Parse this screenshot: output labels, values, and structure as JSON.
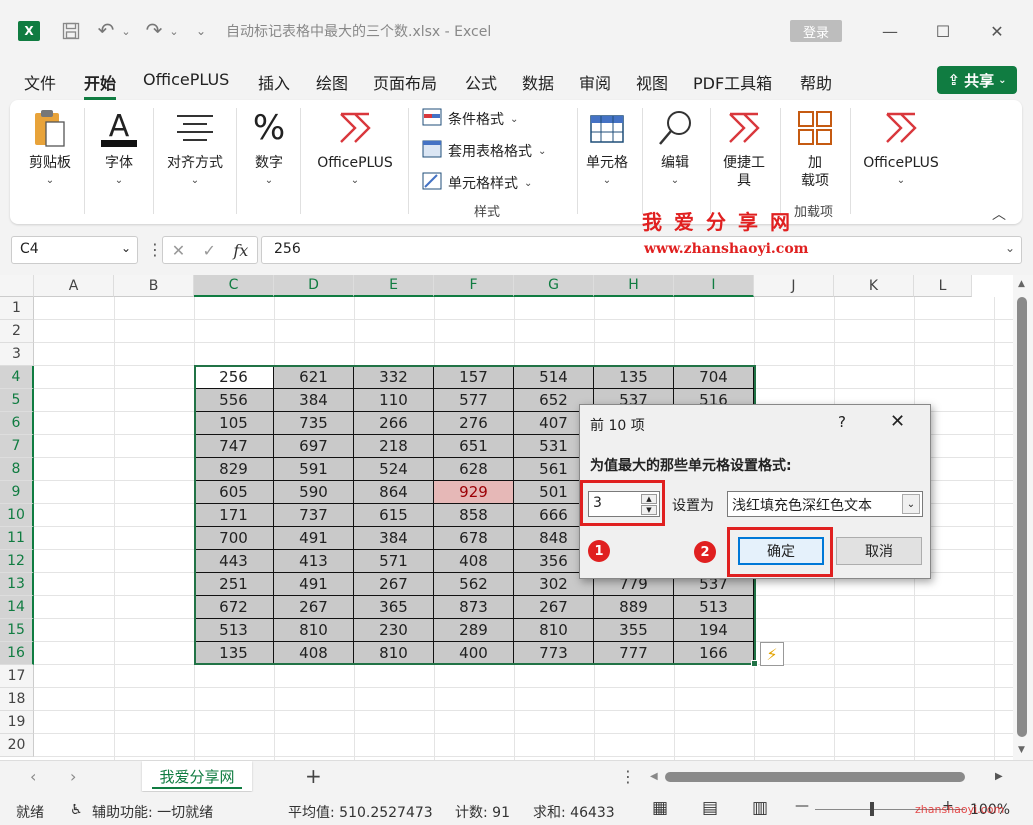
{
  "app": {
    "logo_letter": "X",
    "title": "自动标记表格中最大的三个数.xlsx  -  Excel",
    "login": "登录",
    "undo": "↶",
    "redo": "↷",
    "customize": "⌄"
  },
  "menu": {
    "tabs": [
      "文件",
      "开始",
      "OfficePLUS",
      "插入",
      "绘图",
      "页面布局",
      "公式",
      "数据",
      "审阅",
      "视图",
      "PDF工具箱",
      "帮助"
    ],
    "share": "共享"
  },
  "ribbon": {
    "paste": "剪贴板",
    "font": "字体",
    "align": "对齐方式",
    "number": "数字",
    "officeplus1": "OfficePLUS",
    "cond_format": "条件格式",
    "table_format": "套用表格格式",
    "cell_style": "单元格样式",
    "styles_group": "样式",
    "cells": "单元格",
    "edit": "编辑",
    "tools_line1": "便捷工",
    "tools_line2": "具",
    "addin_line1": "加",
    "addin_line2": "载项",
    "addin_group": "加载项",
    "officeplus2": "OfficePLUS"
  },
  "formula_bar": {
    "name_box": "C4",
    "formula": "256"
  },
  "columns": [
    "A",
    "B",
    "C",
    "D",
    "E",
    "F",
    "G",
    "H",
    "I",
    "J",
    "K",
    "L"
  ],
  "rows": [
    "1",
    "2",
    "3",
    "4",
    "5",
    "6",
    "7",
    "8",
    "9",
    "10",
    "11",
    "12",
    "13",
    "14",
    "15",
    "16",
    "17",
    "18",
    "19",
    "20"
  ],
  "table": [
    [
      "256",
      "621",
      "332",
      "157",
      "514",
      "135",
      "704"
    ],
    [
      "556",
      "384",
      "110",
      "577",
      "652",
      "537",
      "516"
    ],
    [
      "105",
      "735",
      "266",
      "276",
      "407",
      "",
      ""
    ],
    [
      "747",
      "697",
      "218",
      "651",
      "531",
      "",
      ""
    ],
    [
      "829",
      "591",
      "524",
      "628",
      "561",
      "",
      ""
    ],
    [
      "605",
      "590",
      "864",
      "929",
      "501",
      "",
      ""
    ],
    [
      "171",
      "737",
      "615",
      "858",
      "666",
      "",
      ""
    ],
    [
      "700",
      "491",
      "384",
      "678",
      "848",
      "",
      ""
    ],
    [
      "443",
      "413",
      "571",
      "408",
      "356",
      "",
      ""
    ],
    [
      "251",
      "491",
      "267",
      "562",
      "302",
      "779",
      "537"
    ],
    [
      "672",
      "267",
      "365",
      "873",
      "267",
      "889",
      "513"
    ],
    [
      "513",
      "810",
      "230",
      "289",
      "810",
      "355",
      "194"
    ],
    [
      "135",
      "408",
      "810",
      "400",
      "773",
      "777",
      "166"
    ]
  ],
  "dialog": {
    "title": "前 10 项",
    "help": "?",
    "close": "✕",
    "prompt": "为值最大的那些单元格设置格式:",
    "count": "3",
    "set_as": "设置为",
    "format": "浅红填充色深红色文本",
    "ok": "确定",
    "cancel": "取消"
  },
  "annotations": {
    "badge1": "1",
    "badge2": "2",
    "wm_title": "我爱分享网",
    "wm_url": "www.zhanshaoyi.com",
    "wm_url_small": "zhanshaoyi.com"
  },
  "sheet": {
    "tab": "我爱分享网"
  },
  "status": {
    "ready": "就绪",
    "accessibility": "辅助功能: 一切就绪",
    "average": "平均值: 510.2527473",
    "count": "计数: 91",
    "sum": "求和: 46433",
    "zoom": "100%"
  },
  "colors": {
    "excel_green": "#107c41",
    "annotation_red": "#e02020",
    "highlight_fill": "#e6b8b7",
    "highlight_text": "#9c0006"
  }
}
